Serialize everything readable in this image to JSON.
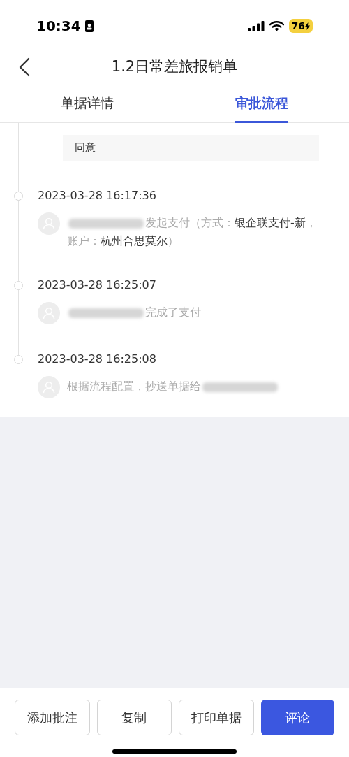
{
  "status_bar": {
    "time": "10:34",
    "battery": "76"
  },
  "header": {
    "title": "1.2日常差旅报销单"
  },
  "tabs": [
    {
      "label": "单据详情",
      "selected": false
    },
    {
      "label": "审批流程",
      "selected": true
    }
  ],
  "comment": "同意",
  "timeline": [
    {
      "time": "2023-03-28 16:17:36",
      "segments": [
        {
          "kind": "redacted"
        },
        {
          "kind": "text",
          "text": "发起支付（方式：",
          "emphasis": false
        },
        {
          "kind": "text",
          "text": "银企联支付-新",
          "emphasis": true
        },
        {
          "kind": "text",
          "text": "，账户：",
          "emphasis": false
        },
        {
          "kind": "text",
          "text": "杭州合思莫尔",
          "emphasis": true
        },
        {
          "kind": "text",
          "text": "）",
          "emphasis": false
        }
      ]
    },
    {
      "time": "2023-03-28 16:25:07",
      "segments": [
        {
          "kind": "redacted"
        },
        {
          "kind": "text",
          "text": "完成了支付",
          "emphasis": false
        }
      ]
    },
    {
      "time": "2023-03-28 16:25:08",
      "segments": [
        {
          "kind": "text",
          "text": "根据流程配置，抄送单据给",
          "emphasis": false
        },
        {
          "kind": "redacted"
        }
      ]
    }
  ],
  "buttons": [
    {
      "label": "添加批注",
      "primary": false
    },
    {
      "label": "复制",
      "primary": false
    },
    {
      "label": "打印单据",
      "primary": false
    },
    {
      "label": "评论",
      "primary": true
    }
  ]
}
